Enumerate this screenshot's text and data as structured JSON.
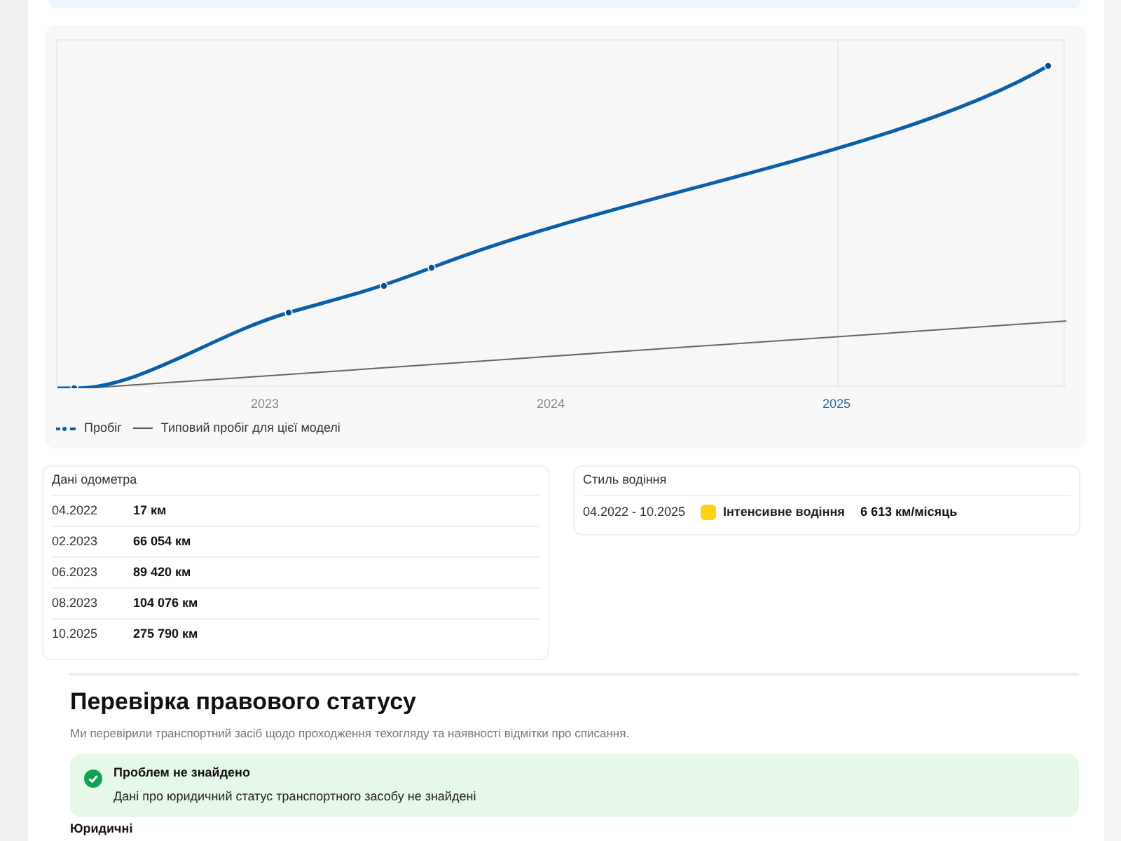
{
  "mileage_chart": {
    "x_labels": [
      {
        "label": "2023",
        "highlighted": false
      },
      {
        "label": "2024",
        "highlighted": false
      },
      {
        "label": "2025",
        "highlighted": true
      }
    ],
    "legend": [
      {
        "kind": "dotted",
        "label": "Пробіг"
      },
      {
        "kind": "line",
        "label": "Типовий пробіг для цієї моделі"
      }
    ]
  },
  "odometer": {
    "title": "Дані одометра",
    "rows": [
      {
        "date": "04.2022",
        "value": "17 км"
      },
      {
        "date": "02.2023",
        "value": "66 054 км"
      },
      {
        "date": "06.2023",
        "value": "89 420 км"
      },
      {
        "date": "08.2023",
        "value": "104 076 км"
      },
      {
        "date": "10.2025",
        "value": "275 790 км"
      }
    ]
  },
  "driving_style": {
    "title": "Стиль водіння",
    "rows": [
      {
        "period": "04.2022 - 10.2025",
        "color": "#fcd116",
        "style": "Інтенсивне водіння",
        "rate": "6 613 км/місяць"
      }
    ]
  },
  "legal_status": {
    "title": "Перевірка правового статусу",
    "subtitle": "Ми перевірили транспортний засіб щодо проходження техогляду та наявності відмітки про списання.",
    "alert": {
      "kind": "success",
      "title": "Проблем не знайдено",
      "text": "Дані про юридичний статус транспортного засобу не знайдені"
    },
    "next_heading": "Юридичні"
  }
}
